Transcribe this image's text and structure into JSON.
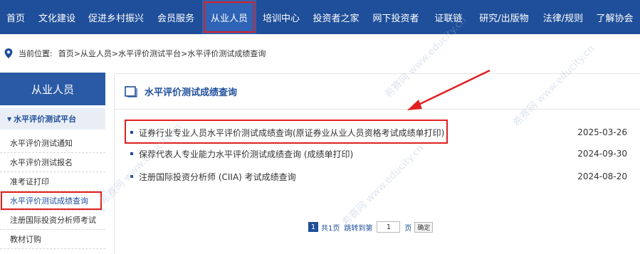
{
  "nav": {
    "items": [
      {
        "label": "首页"
      },
      {
        "label": "文化建设"
      },
      {
        "label": "促进乡村振兴"
      },
      {
        "label": "会员服务"
      },
      {
        "label": "从业人员"
      },
      {
        "label": "培训中心"
      },
      {
        "label": "投资者之家"
      },
      {
        "label": "网下投资者"
      },
      {
        "label": "证联链"
      },
      {
        "label": "研究/出版物"
      },
      {
        "label": "法律/规则"
      },
      {
        "label": "了解协会"
      }
    ],
    "active_label": "从业人员"
  },
  "breadcrumb": {
    "prefix": "当前位置:",
    "path": "首页>从业人员>水平评价测试平台>水平评价测试成绩查询"
  },
  "sidebar": {
    "title": "从业人员",
    "section": "水平评价测试平台",
    "items": [
      {
        "label": "水平评价测试通知"
      },
      {
        "label": "水平评价测试报名"
      },
      {
        "label": "准考证打印"
      },
      {
        "label": "水平评价测试成绩查询"
      },
      {
        "label": "注册国际投资分析师考试"
      },
      {
        "label": "教材订购"
      }
    ]
  },
  "main": {
    "title": "水平评价测试成绩查询",
    "rows": [
      {
        "title": "证券行业专业人员水平评价测试成绩查询(原证券业从业人员资格考试成绩单打印)",
        "date": "2025-03-26"
      },
      {
        "title": "保荐代表人专业能力水平评价测试成绩查询 (成绩单打印)",
        "date": "2024-09-30"
      },
      {
        "title": "注册国际投资分析师 (CIIA) 考试成绩查询",
        "date": "2024-08-20"
      }
    ]
  },
  "pager": {
    "current": "1",
    "total": "共1页",
    "jump_label": "跳转到第",
    "input_value": "1",
    "unit": "页",
    "confirm": "确定"
  },
  "watermark": "希赛网 www.educity.cn",
  "colors": {
    "nav_bg": "#1f4f9a",
    "accent": "#1f4f9a",
    "highlight": "#e02020"
  }
}
